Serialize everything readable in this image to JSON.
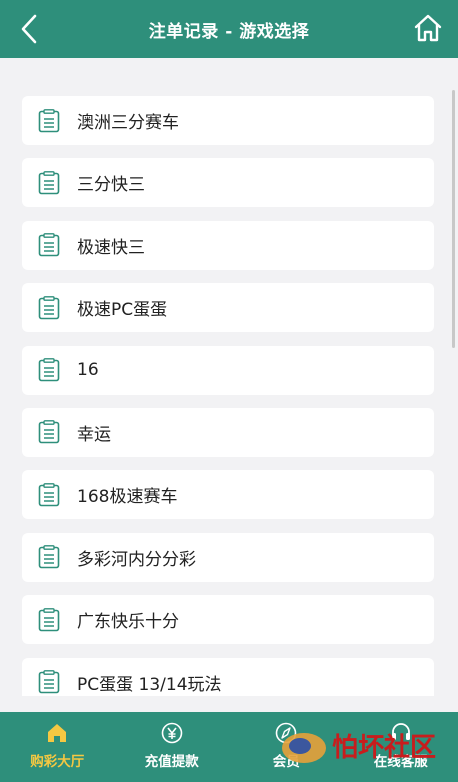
{
  "header": {
    "title": "注单记录 - 游戏选择",
    "back_icon": "chevron-left-icon",
    "home_icon": "home-icon"
  },
  "games": [
    {
      "label": "澳洲三分赛车"
    },
    {
      "label": "三分快三"
    },
    {
      "label": "极速快三"
    },
    {
      "label": "极速PC蛋蛋"
    },
    {
      "label": "16"
    },
    {
      "label": "幸运"
    },
    {
      "label": "168极速赛车"
    },
    {
      "label": "多彩河内分分彩"
    },
    {
      "label": "广东快乐十分"
    },
    {
      "label": "PC蛋蛋 13/14玩法"
    }
  ],
  "footer": {
    "tabs": [
      {
        "label": "购彩大厅",
        "icon": "home-icon",
        "active": true
      },
      {
        "label": "充值提款",
        "icon": "yen-icon",
        "active": false
      },
      {
        "label": "会员",
        "icon": "compass-icon",
        "active": false
      },
      {
        "label": "在线客服",
        "icon": "headset-icon",
        "active": false
      }
    ]
  },
  "watermark": {
    "text": "怕坏社区"
  },
  "colors": {
    "primary": "#2e8f7b",
    "active_tab": "#f5c842",
    "background": "#f2f2f4"
  }
}
